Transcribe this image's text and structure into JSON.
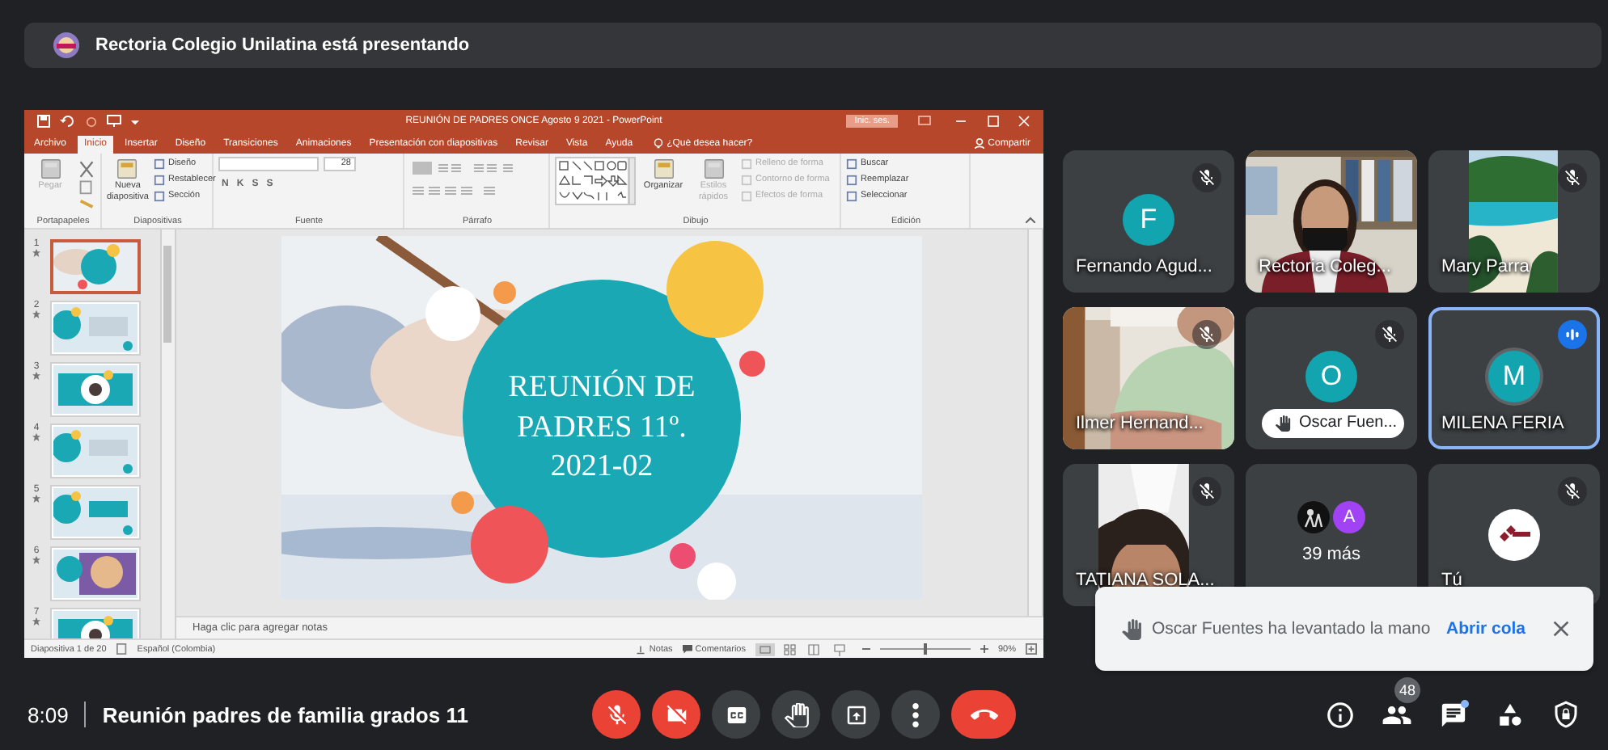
{
  "presenting_bar": {
    "text": "Rectoria Colegio Unilatina está presentando"
  },
  "shared_screen": {
    "title_bar": {
      "title": "REUNIÓN DE PADRES ONCE Agosto 9 2021 - PowerPoint",
      "sign_in": "Inic. ses."
    },
    "tabs": [
      {
        "label": "Archivo",
        "selected": false
      },
      {
        "label": "Inicio",
        "selected": true
      },
      {
        "label": "Insertar",
        "selected": false
      },
      {
        "label": "Diseño",
        "selected": false
      },
      {
        "label": "Transiciones",
        "selected": false
      },
      {
        "label": "Animaciones",
        "selected": false
      },
      {
        "label": "Presentación con diapositivas",
        "selected": false
      },
      {
        "label": "Revisar",
        "selected": false
      },
      {
        "label": "Vista",
        "selected": false
      },
      {
        "label": "Ayuda",
        "selected": false
      }
    ],
    "search": {
      "placeholder": "¿Qué desea hacer?"
    },
    "share": "Compartir",
    "ribbon": [
      {
        "label": "Portapapeles",
        "items": [
          {
            "kind": "large",
            "label": "Pegar",
            "disabled": true
          },
          {
            "kind": "tools"
          }
        ]
      },
      {
        "label": "Diapositivas",
        "items": [
          {
            "kind": "large",
            "label": "Nueva diapositiva",
            "disabled": false
          },
          {
            "kind": "small",
            "label": "Diseño",
            "disabled": false
          },
          {
            "kind": "small",
            "label": "Restablecer",
            "disabled": false
          },
          {
            "kind": "small",
            "label": "Sección",
            "disabled": false
          }
        ]
      },
      {
        "label": "Fuente",
        "items": [
          {
            "kind": "field",
            "label": "28"
          },
          {
            "kind": "styles",
            "labels": [
              "N",
              "K",
              "S",
              "S"
            ]
          }
        ]
      },
      {
        "label": "Párrafo",
        "items": [
          {
            "kind": "align"
          }
        ]
      },
      {
        "label": "Dibujo",
        "items": [
          {
            "kind": "gallery"
          },
          {
            "kind": "large",
            "label": "Organizar",
            "disabled": false
          },
          {
            "kind": "large",
            "label": "Estilos rápidos",
            "disabled": true
          },
          {
            "kind": "small",
            "label": "Relleno de forma",
            "disabled": true
          },
          {
            "kind": "small",
            "label": "Contorno de forma",
            "disabled": true
          },
          {
            "kind": "small",
            "label": "Efectos de forma",
            "disabled": true
          }
        ]
      },
      {
        "label": "Edición",
        "items": [
          {
            "kind": "small",
            "label": "Buscar",
            "disabled": false
          },
          {
            "kind": "small",
            "label": "Reemplazar",
            "disabled": false
          },
          {
            "kind": "small",
            "label": "Seleccionar",
            "disabled": false
          }
        ]
      }
    ],
    "thumbnails": [
      {
        "number": "1",
        "selected": true
      },
      {
        "number": "2",
        "selected": false
      },
      {
        "number": "3",
        "selected": false
      },
      {
        "number": "4",
        "selected": false
      },
      {
        "number": "5",
        "selected": false
      },
      {
        "number": "6",
        "selected": false
      },
      {
        "number": "7",
        "selected": false
      }
    ],
    "slide": {
      "title": [
        "REUNIÓN DE",
        "PADRES 11º.",
        "2021-02"
      ]
    },
    "notes": {
      "placeholder": "Haga clic para agregar notas"
    },
    "status_bar": {
      "slide": "Diapositiva 1 de 20",
      "language": "Español (Colombia)",
      "notes": "Notas",
      "comments": "Comentarios",
      "zoom_slider": {
        "level": 0.5
      },
      "zoom": "90%"
    }
  },
  "tiles": [
    {
      "kind": "avatar",
      "name": "Fernando Agud...",
      "initial": "F",
      "muted": true,
      "speaking": false,
      "hand_raised": false
    },
    {
      "kind": "video",
      "name": "Rectoria Coleg...",
      "muted": false,
      "speaking": false,
      "hand_raised": false
    },
    {
      "kind": "video",
      "name": "Mary Parra",
      "muted": true,
      "speaking": false,
      "hand_raised": false
    },
    {
      "kind": "video",
      "name": "Ilmer Hernand...",
      "muted": true,
      "speaking": false,
      "hand_raised": false
    },
    {
      "kind": "avatar",
      "name": "Oscar Fuen...",
      "initial": "O",
      "muted": true,
      "speaking": false,
      "hand_raised": true
    },
    {
      "kind": "avatar",
      "name": "MILENA FERIA",
      "initial": "M",
      "muted": false,
      "speaking": true,
      "hand_raised": false
    },
    {
      "kind": "video",
      "name": "TATIANA SOLA...",
      "muted": true,
      "speaking": false,
      "hand_raised": false
    },
    {
      "kind": "more",
      "label": "39 más",
      "avatars": [
        {
          "kind": "picture"
        },
        {
          "kind": "letter",
          "initial": "A"
        }
      ]
    },
    {
      "kind": "logo",
      "name": "Tú",
      "muted": true,
      "speaking": false,
      "hand_raised": false
    }
  ],
  "toast": {
    "message": "Oscar Fuentes ha levantado la mano",
    "action": "Abrir cola"
  },
  "bottom_bar": {
    "time": "8:09",
    "meeting_title": "Reunión padres de familia grados 11",
    "controls": [
      {
        "kind": "mic",
        "on": false
      },
      {
        "kind": "camera",
        "on": false
      },
      {
        "kind": "captions",
        "on": false
      },
      {
        "kind": "hand",
        "on": false
      },
      {
        "kind": "present"
      },
      {
        "kind": "more"
      },
      {
        "kind": "end"
      }
    ],
    "side": [
      {
        "kind": "info"
      },
      {
        "kind": "people",
        "badge": "48"
      },
      {
        "kind": "chat",
        "unread": true
      },
      {
        "kind": "activities"
      },
      {
        "kind": "safety"
      }
    ]
  }
}
